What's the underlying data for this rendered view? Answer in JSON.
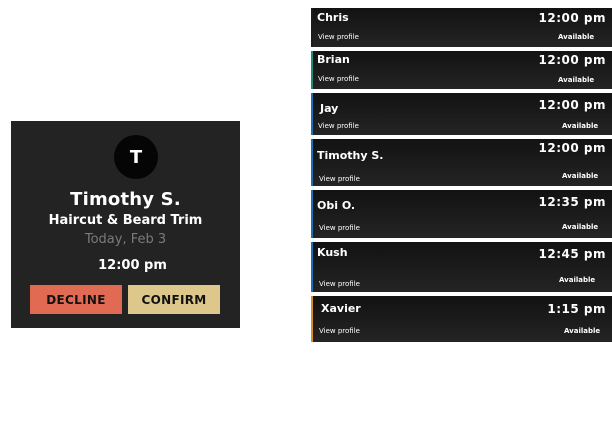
{
  "booking": {
    "avatar_initial": "T",
    "name": "Timothy S.",
    "service": "Haircut & Beard Trim",
    "date": "Today, Feb 3",
    "time": "12:00 pm",
    "decline_label": "DECLINE",
    "confirm_label": "CONFIRM",
    "decline_color": "#e06b52",
    "confirm_color": "#ddc78a"
  },
  "barbers": [
    {
      "name": "Chris",
      "link": "View profile",
      "time": "12:00 pm",
      "status": "Available",
      "accent": "#1c1c1c"
    },
    {
      "name": "Brian",
      "link": "View profile",
      "time": "12:00 pm",
      "status": "Available",
      "accent": "#1f8a7a"
    },
    {
      "name": "Jay",
      "link": "View profile",
      "time": "12:00 pm",
      "status": "Available",
      "accent": "#1e6fb8"
    },
    {
      "name": "Timothy S.",
      "link": "View profile",
      "time": "12:00 pm",
      "status": "Available",
      "accent": "#1e6fb8"
    },
    {
      "name": "Obi O.",
      "link": "View profile",
      "time": "12:35 pm",
      "status": "Available",
      "accent": "#1e6fb8"
    },
    {
      "name": "Kush",
      "link": "View profile",
      "time": "12:45 pm",
      "status": "Available",
      "accent": "#1e6fb8"
    },
    {
      "name": "Xavier",
      "link": "View profile",
      "time": "1:15 pm",
      "status": "Available",
      "accent": "#d98c2a"
    }
  ]
}
